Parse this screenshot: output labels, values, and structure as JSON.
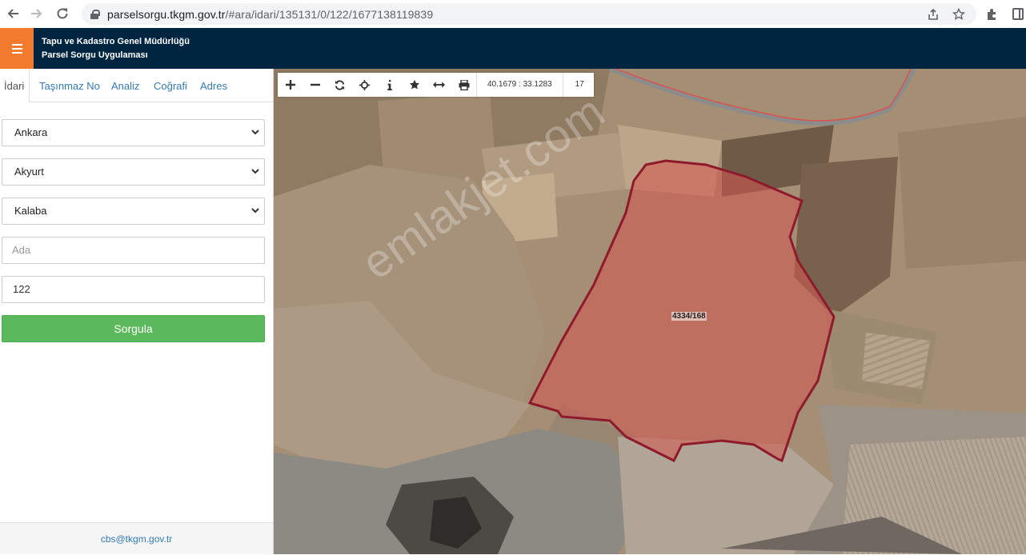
{
  "browser": {
    "url_domain": "parselsorgu.tkgm.gov.tr",
    "url_rest": "/#ara/idari/135131/0/122/1677138119839"
  },
  "header": {
    "title_line1": "Tapu ve Kadastro Genel Müdürlüğü",
    "title_line2": "Parsel Sorgu Uygulaması",
    "accent_color": "#f37b30",
    "bar_color": "#002541"
  },
  "tabs": [
    {
      "label": "İdari"
    },
    {
      "label": "Taşınmaz No"
    },
    {
      "label": "Analiz"
    },
    {
      "label": "Coğrafi"
    },
    {
      "label": "Adres"
    }
  ],
  "form": {
    "il": "Ankara",
    "ilce": "Akyurt",
    "mahalle": "Kalaba",
    "ada_placeholder": "Ada",
    "parsel_value": "122",
    "submit_label": "Sorgula"
  },
  "footer": {
    "email": "cbs@tkgm.gov.tr"
  },
  "map": {
    "coordinates": "40.1679 : 33.1283",
    "zoom_level": "17",
    "parcel_label": "4334/168",
    "watermark": "emlakjet.com",
    "tools": [
      "zoom-in",
      "zoom-out",
      "refresh",
      "locate",
      "info",
      "favorite",
      "measure",
      "print"
    ]
  }
}
